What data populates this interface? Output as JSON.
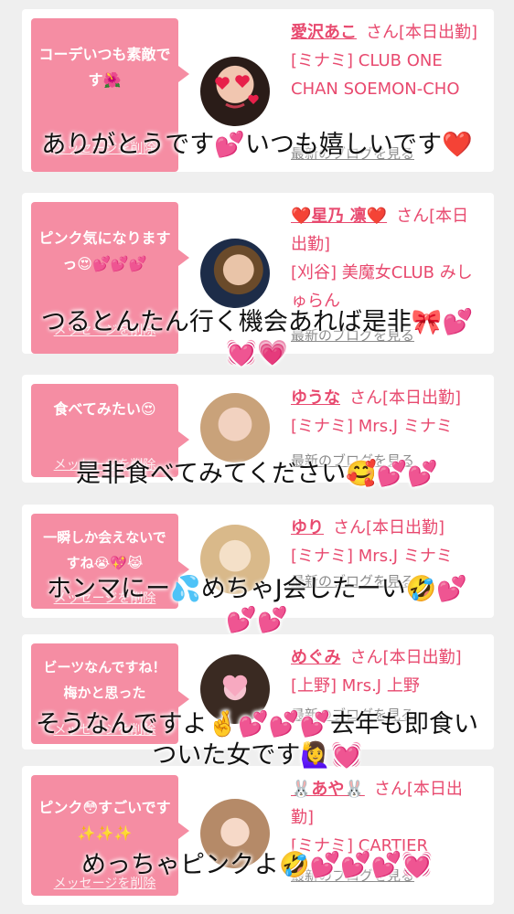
{
  "cards": [
    {
      "message": "コーデいつも素敵です🌺",
      "delete_label": "メッセージを削除",
      "name": "愛沢あこ",
      "suffix": "さん[本日出勤]",
      "shop": "[ミナミ] CLUB ONE CHAN SOEMON-CHO",
      "blog_link": "最新のブログを見る",
      "comment": "ありがとうです💕いつも嬉しいです❤️"
    },
    {
      "message": "ピンク気になりますっ😍💕💕💕",
      "delete_label": "メッセージを削除",
      "name": "❤️星乃 凛❤️",
      "suffix": "さん[本日出勤]",
      "shop": "[刈谷] 美魔女CLUB みしゅらん",
      "blog_link": "最新のブログを見る",
      "comment": "つるとんたん行く機会あれば是非🎀💕\n💓💗"
    },
    {
      "message": "食べてみたい😍",
      "delete_label": "メッセージを削除",
      "name": "ゆうな",
      "suffix": "さん[本日出勤]",
      "shop": "[ミナミ] Mrs.J ミナミ",
      "blog_link": "最新のブログを見る",
      "comment": "是非食べてみてください🥰💕💕"
    },
    {
      "message": "一瞬しか会えないですね😭💖😹",
      "delete_label": "メッセージを削除",
      "name": "ゆり",
      "suffix": "さん[本日出勤]",
      "shop": "[ミナミ] Mrs.J ミナミ",
      "blog_link": "最新のブログを見る",
      "comment": "ホンマにー💦めちゃJ会したーい🤣💕\n💕💕"
    },
    {
      "message": "ビーツなんですね！梅かと思った",
      "delete_label": "メッセージを削除",
      "name": "めぐみ",
      "suffix": "さん[本日出勤]",
      "shop": "[上野] Mrs.J 上野",
      "blog_link": "最新のブログを見る",
      "comment": "そうなんですよ🤞💕💕💕去年も即食い\nついた女です🙋‍♀️💓"
    },
    {
      "message": "ピンク😳すごいです✨✨✨",
      "delete_label": "メッセージを削除",
      "name": "🐰あや🐰",
      "suffix": "さん[本日出勤]",
      "shop": "[ミナミ] CARTIER",
      "blog_link": "最新のブログを見る",
      "comment": "めっちゃピンクよ🤣💕💕💕💓"
    }
  ],
  "colors": {
    "background": "#efefef",
    "bubble": "#f58da3",
    "name_link": "#e84a6f",
    "comment_text": "#111111"
  }
}
